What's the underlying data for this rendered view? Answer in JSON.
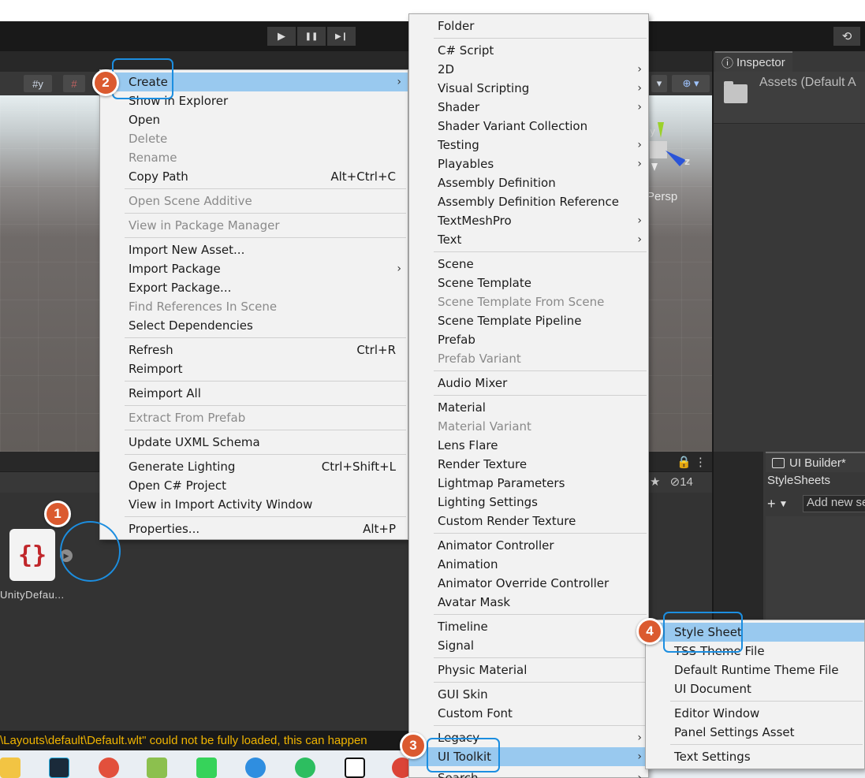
{
  "toolbar": {
    "play_icon": "▶",
    "pause_icon": "❚❚",
    "step_icon": "▶❙",
    "history_icon": "⟲"
  },
  "scene": {
    "persp_label": "Persp",
    "gizmo_axis_y": "y",
    "gizmo_axis_z": "z",
    "tool_grid_label": "#y",
    "tool_snap_label": "#"
  },
  "inspector": {
    "tab_label": "Inspector",
    "tab_icon": "ⓘ",
    "title": "Assets (Default A"
  },
  "project": {
    "asset_label": "UnityDefau...",
    "asset_glyph": "{}",
    "lock_icons": "🔒 ⋮",
    "hidden_count": "14"
  },
  "ui_builder": {
    "tab_label": "UI Builder*",
    "heading": "StyleSheets",
    "add_icon": "+",
    "add_placeholder": "Add new se"
  },
  "console": {
    "message": "\\Layouts\\default\\Default.wlt\" could not be fully loaded, this can happen"
  },
  "menu_main": {
    "items": [
      {
        "label": "Create",
        "arrow": true,
        "highlighted": true
      },
      {
        "label": "Show in Explorer"
      },
      {
        "label": "Open"
      },
      {
        "label": "Delete",
        "disabled": true
      },
      {
        "label": "Rename",
        "disabled": true
      },
      {
        "label": "Copy Path",
        "shortcut": "Alt+Ctrl+C"
      },
      {
        "label": "Open Scene Additive",
        "disabled": true
      },
      {
        "label": "View in Package Manager",
        "disabled": true
      },
      {
        "label": "Import New Asset..."
      },
      {
        "label": "Import Package",
        "arrow": true
      },
      {
        "label": "Export Package..."
      },
      {
        "label": "Find References In Scene",
        "disabled": true
      },
      {
        "label": "Select Dependencies"
      },
      {
        "label": "Refresh",
        "shortcut": "Ctrl+R"
      },
      {
        "label": "Reimport"
      },
      {
        "label": "Reimport All"
      },
      {
        "label": "Extract From Prefab",
        "disabled": true
      },
      {
        "label": "Update UXML Schema"
      },
      {
        "label": "Generate Lighting",
        "shortcut": "Ctrl+Shift+L"
      },
      {
        "label": "Open C# Project"
      },
      {
        "label": "View in Import Activity Window"
      },
      {
        "label": "Properties...",
        "shortcut": "Alt+P"
      }
    ]
  },
  "menu_create": {
    "items": [
      {
        "label": "Folder"
      },
      {
        "label": "C# Script"
      },
      {
        "label": "2D",
        "arrow": true
      },
      {
        "label": "Visual Scripting",
        "arrow": true
      },
      {
        "label": "Shader",
        "arrow": true
      },
      {
        "label": "Shader Variant Collection"
      },
      {
        "label": "Testing",
        "arrow": true
      },
      {
        "label": "Playables",
        "arrow": true
      },
      {
        "label": "Assembly Definition"
      },
      {
        "label": "Assembly Definition Reference"
      },
      {
        "label": "TextMeshPro",
        "arrow": true
      },
      {
        "label": "Text",
        "arrow": true
      },
      {
        "label": "Scene"
      },
      {
        "label": "Scene Template"
      },
      {
        "label": "Scene Template From Scene",
        "disabled": true
      },
      {
        "label": "Scene Template Pipeline"
      },
      {
        "label": "Prefab"
      },
      {
        "label": "Prefab Variant",
        "disabled": true
      },
      {
        "label": "Audio Mixer"
      },
      {
        "label": "Material"
      },
      {
        "label": "Material Variant",
        "disabled": true
      },
      {
        "label": "Lens Flare"
      },
      {
        "label": "Render Texture"
      },
      {
        "label": "Lightmap Parameters"
      },
      {
        "label": "Lighting Settings"
      },
      {
        "label": "Custom Render Texture"
      },
      {
        "label": "Animator Controller"
      },
      {
        "label": "Animation"
      },
      {
        "label": "Animator Override Controller"
      },
      {
        "label": "Avatar Mask"
      },
      {
        "label": "Timeline"
      },
      {
        "label": "Signal"
      },
      {
        "label": "Physic Material"
      },
      {
        "label": "GUI Skin"
      },
      {
        "label": "Custom Font"
      },
      {
        "label": "Legacy",
        "arrow": true
      },
      {
        "label": "UI Toolkit",
        "arrow": true,
        "highlighted": true
      },
      {
        "label": "Search",
        "arrow": true
      }
    ]
  },
  "menu_uitoolkit": {
    "items": [
      {
        "label": "Style Sheet",
        "highlighted": true
      },
      {
        "label": "TSS Theme File"
      },
      {
        "label": "Default Runtime Theme File"
      },
      {
        "label": "UI Document"
      },
      {
        "label": "Editor Window"
      },
      {
        "label": "Panel Settings Asset"
      },
      {
        "label": "Text Settings"
      }
    ]
  },
  "annotations": {
    "step1": "1",
    "step2": "2",
    "step3": "3",
    "step4": "4"
  },
  "colors": {
    "menu_bg": "#f2f2f2",
    "menu_highlight": "#99c9ef",
    "badge": "#db5a2f",
    "annotation_outline": "#1c8ee0",
    "console_warning": "#f0b400"
  }
}
